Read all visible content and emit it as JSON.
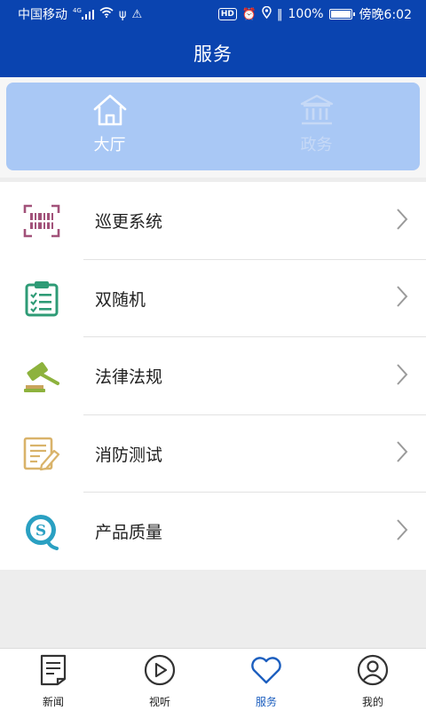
{
  "status_bar": {
    "carrier": "中国移动",
    "network": "4G",
    "battery": "100%",
    "time": "傍晚6:02",
    "hd_badge": "HD"
  },
  "header": {
    "title": "服务"
  },
  "tabs": [
    {
      "label": "大厅",
      "icon": "home-icon",
      "active": true
    },
    {
      "label": "政务",
      "icon": "government-building-icon",
      "active": false
    }
  ],
  "services": [
    {
      "label": "巡更系统",
      "icon": "barcode-scan-icon",
      "color": "#a2527a"
    },
    {
      "label": "双随机",
      "icon": "clipboard-checklist-icon",
      "color": "#2e9b76"
    },
    {
      "label": "法律法规",
      "icon": "gavel-icon",
      "color": "#8db23d"
    },
    {
      "label": "消防测试",
      "icon": "document-edit-icon",
      "color": "#d9b36a"
    },
    {
      "label": "产品质量",
      "icon": "quality-s-logo-icon",
      "color": "#2aa0c2"
    }
  ],
  "bottom_nav": [
    {
      "label": "新闻",
      "icon": "news-icon",
      "active": false
    },
    {
      "label": "视听",
      "icon": "play-icon",
      "active": false
    },
    {
      "label": "服务",
      "icon": "heart-icon",
      "active": true
    },
    {
      "label": "我的",
      "icon": "user-icon",
      "active": false
    }
  ],
  "colors": {
    "header_bg": "#0a44b0",
    "tab_panel_bg": "#a9c8f5",
    "active_nav": "#1d5fbf"
  }
}
